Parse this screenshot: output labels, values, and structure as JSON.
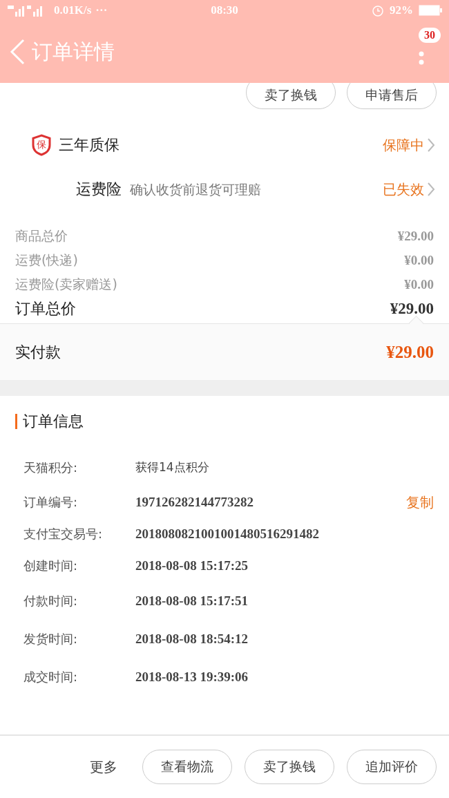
{
  "status_bar": {
    "network": "0.01K/s",
    "dots": "···",
    "time": "08:30",
    "battery": "92%"
  },
  "header": {
    "title": "订单详情",
    "badge": "30"
  },
  "top_actions": [
    "卖了换钱",
    "申请售后"
  ],
  "services": [
    {
      "kind": "warranty",
      "badge": "保",
      "name": "三年质保",
      "status": "保障中"
    },
    {
      "kind": "insurance",
      "name": "运费险",
      "note": "确认收货前退货可理赔",
      "status": "已失效"
    }
  ],
  "price_lines": [
    {
      "label": "商品总价",
      "value": "¥29.00",
      "kind": "minor"
    },
    {
      "label": "运费(快递)",
      "value": "¥0.00",
      "kind": "minor"
    },
    {
      "label": "运费险(卖家赠送)",
      "value": "¥0.00",
      "kind": "minor"
    },
    {
      "label": "订单总价",
      "value": "¥29.00",
      "kind": "total"
    }
  ],
  "paid": {
    "label": "实付款",
    "value": "¥29.00"
  },
  "order_info": {
    "title": "订单信息",
    "rows": [
      {
        "label": "天猫积分:",
        "value": "获得14点积分"
      },
      {
        "label": "订单编号:",
        "value": "197126282144773282",
        "action": "复制"
      },
      {
        "label": "支付宝交易号:",
        "value": "2018080821001001480516291482"
      },
      {
        "label": "创建时间:",
        "value": "2018-08-08 15:17:25"
      },
      {
        "label": "付款时间:",
        "value": "2018-08-08 15:17:51"
      },
      {
        "label": "发货时间:",
        "value": "2018-08-08 18:54:12"
      },
      {
        "label": "成交时间:",
        "value": "2018-08-13 19:39:06"
      }
    ]
  },
  "bottom_bar": {
    "more": "更多",
    "buttons": [
      "查看物流",
      "卖了换钱",
      "追加评价"
    ]
  }
}
